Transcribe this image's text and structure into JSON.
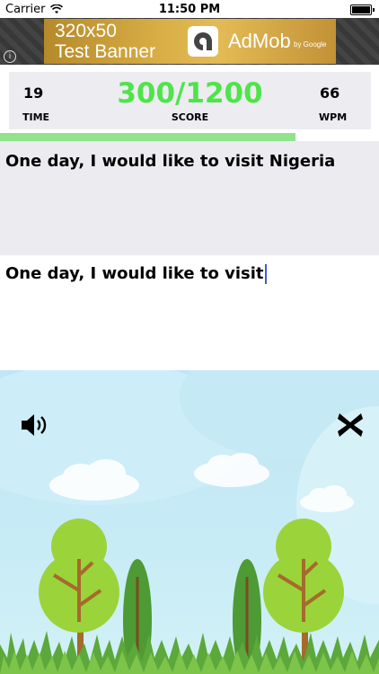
{
  "status_bar": {
    "carrier": "Carrier",
    "time": "11:50 PM"
  },
  "ad": {
    "banner_line1": "320x50",
    "banner_line2": "Test Banner",
    "brand": "AdMob",
    "brand_sub": "by Google",
    "info_glyph": "i"
  },
  "stats": {
    "time_value": "19",
    "time_label": "TIME",
    "score_value": "300/1200",
    "score_label": "SCORE",
    "wpm_value": "66",
    "wpm_label": "WPM"
  },
  "progress": {
    "fraction": 0.78,
    "fill_color": "#8fe48b"
  },
  "game": {
    "target_sentence": "One day, I would like to visit Nigeria",
    "typed_text": "One day, I would like to visit"
  },
  "controls": {
    "sound_icon": "speaker-icon",
    "close_icon": "close-x-icon"
  },
  "colors": {
    "score": "#4ee44a",
    "panel": "#ececf0",
    "cursor": "#3d5bd8"
  }
}
